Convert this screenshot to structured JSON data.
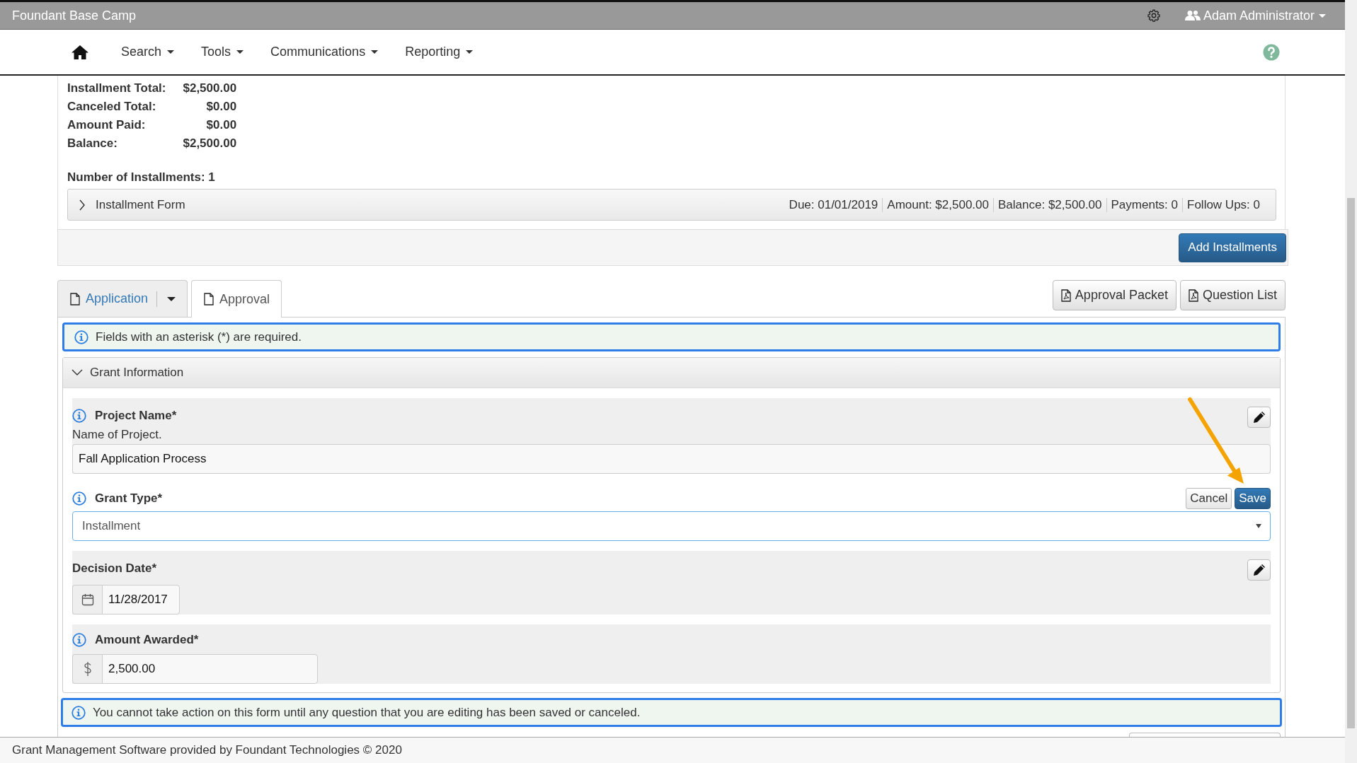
{
  "app": {
    "title": "Foundant Base Camp",
    "user": "Adam Administrator"
  },
  "nav": [
    {
      "label": "Search"
    },
    {
      "label": "Tools"
    },
    {
      "label": "Communications"
    },
    {
      "label": "Reporting"
    }
  ],
  "summary": {
    "rows": [
      {
        "label": "Installment Total:",
        "value": "$2,500.00"
      },
      {
        "label": "Canceled Total:",
        "value": "$0.00"
      },
      {
        "label": "Amount Paid:",
        "value": "$0.00"
      },
      {
        "label": "Balance:",
        "value": "$2,500.00"
      }
    ],
    "count": "Number of Installments: 1"
  },
  "installments": [
    {
      "title": "Installment Form",
      "expanded": false,
      "stats": [
        "Due: 01/01/2019",
        "Amount: $2,500.00",
        "Balance: $2,500.00",
        "Payments: 0",
        "Follow Ups: 0"
      ]
    }
  ],
  "add_button": "Add Installments",
  "tabs": [
    {
      "label": "Application",
      "selected": false,
      "dropdown": true
    },
    {
      "label": "Approval",
      "selected": true,
      "dropdown": false
    }
  ],
  "actions": [
    "Approval Packet",
    "Question List"
  ],
  "notice": "Fields with an asterisk (*) are required.",
  "section": {
    "title": "Grant Information",
    "expanded": true,
    "questions": [
      {
        "kind": "text",
        "label": "Project Name*",
        "info": true,
        "description": "Name of Project.",
        "value": "Fall Application Process",
        "editable": true,
        "editing": false
      },
      {
        "kind": "select",
        "label": "Grant Type*",
        "info": true,
        "value": "Installment",
        "editable": false,
        "editing": true
      },
      {
        "kind": "date",
        "label": "Decision Date*",
        "info": false,
        "value": "11/28/2017",
        "editable": true,
        "editing": false
      },
      {
        "kind": "currency",
        "label": "Amount Awarded*",
        "info": true,
        "value": "2,500.00",
        "editable": false,
        "editing": false
      }
    ]
  },
  "edit_buttons": [
    "Cancel",
    "Save"
  ],
  "warning": "You cannot take action on this form until any question that you are editing has been saved or canceled.",
  "footer": "Grant Management Software provided by Foundant Technologies © 2020"
}
